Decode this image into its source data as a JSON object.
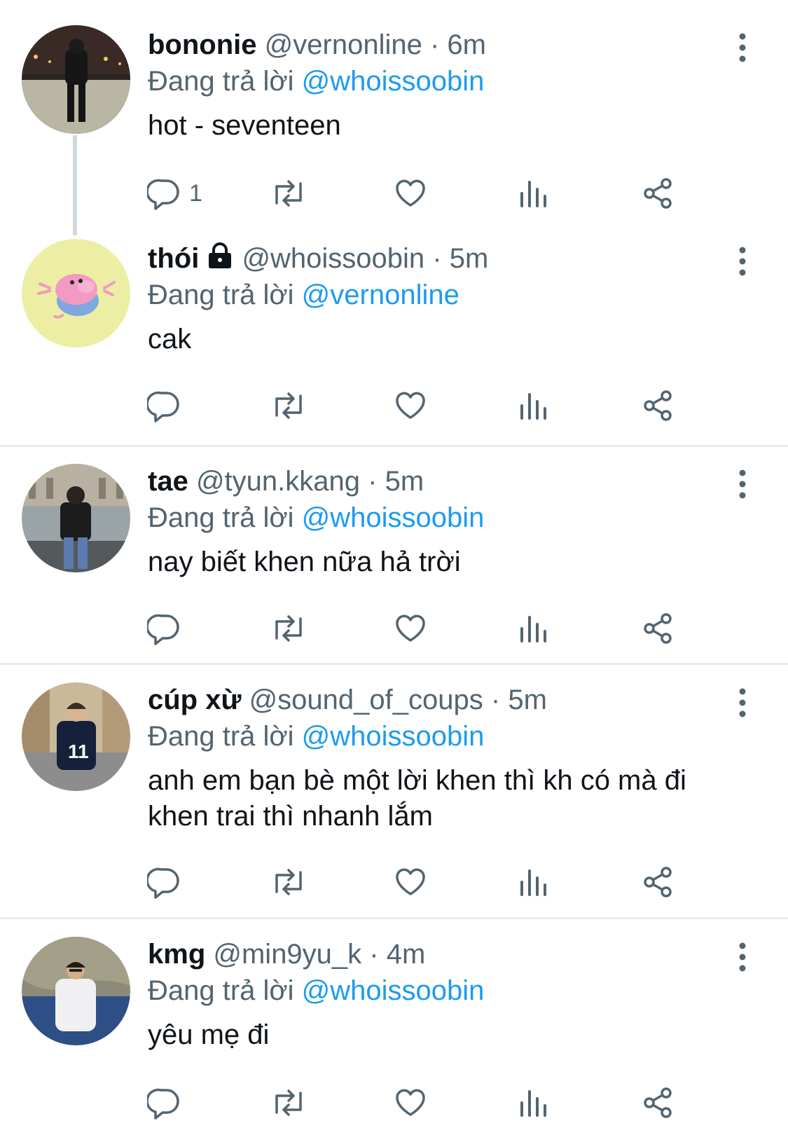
{
  "colors": {
    "accent": "#1d9bf0",
    "text": "#0f1419",
    "secondary": "#536471",
    "divider": "#e6ecf0"
  },
  "replies": [
    {
      "name": "bononie",
      "handle": "@vernonline",
      "time": "6m",
      "locked": false,
      "replying_label": "Đang trả lời",
      "replying_to": "@whoissoobin",
      "text_lines": [
        "hot - seventeen"
      ],
      "reply_count": "1",
      "avatar_icon": "photo-person-night-avatar"
    },
    {
      "name": "thói",
      "handle": "@whoissoobin",
      "time": "5m",
      "locked": true,
      "replying_label": "Đang trả lời",
      "replying_to": "@vernonline",
      "text_lines": [
        "cak"
      ],
      "reply_count": "",
      "avatar_icon": "cartoon-pig-avatar"
    },
    {
      "name": "tae",
      "handle": "@tyun.kkang",
      "time": "5m",
      "locked": false,
      "replying_label": "Đang trả lời",
      "replying_to": "@whoissoobin",
      "text_lines": [
        "nay biết khen nữa hả trời"
      ],
      "reply_count": "",
      "avatar_icon": "photo-person-sitting-avatar"
    },
    {
      "name": "cúp xừ",
      "handle": "@sound_of_coups",
      "time": "5m",
      "locked": false,
      "replying_label": "Đang trả lời",
      "replying_to": "@whoissoobin",
      "text_lines": [
        "anh em bạn bè một lời khen thì kh có mà đi",
        "khen trai thì nhanh lắm"
      ],
      "reply_count": "",
      "avatar_icon": "photo-person-street-avatar"
    },
    {
      "name": "kmg",
      "handle": "@min9yu_k",
      "time": "4m",
      "locked": false,
      "replying_label": "Đang trả lời",
      "replying_to": "@whoissoobin",
      "text_lines": [
        "yêu mẹ đi"
      ],
      "reply_count": "",
      "avatar_icon": "photo-person-sea-avatar"
    }
  ],
  "separator": "·",
  "icons": [
    "reply-icon",
    "retweet-icon",
    "like-icon",
    "views-icon",
    "share-icon",
    "more-icon",
    "lock-icon"
  ]
}
